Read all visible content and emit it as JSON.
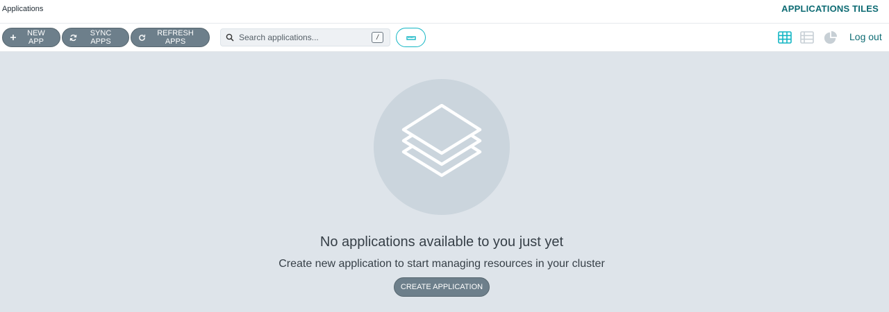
{
  "header": {
    "breadcrumb": "Applications",
    "title": "APPLICATIONS TILES"
  },
  "toolbar": {
    "new_app": {
      "icon": "plus-icon",
      "label": "NEW APP"
    },
    "sync_apps": {
      "icon": "sync-icon",
      "label": "SYNC APPS"
    },
    "refresh_apps": {
      "icon": "refresh-icon",
      "label": "REFRESH APPS"
    },
    "search": {
      "placeholder": "Search applications...",
      "value": "",
      "shortcut": "/"
    },
    "filter_button": {
      "icon": "filter-icon"
    },
    "views": [
      {
        "icon": "tiles-view-icon",
        "active": true
      },
      {
        "icon": "list-view-icon",
        "active": false
      },
      {
        "icon": "pie-chart-icon",
        "active": false
      }
    ],
    "logout": "Log out"
  },
  "empty_state": {
    "icon": "layers-icon",
    "title": "No applications available to you just yet",
    "subtitle": "Create new application to start managing resources in your cluster",
    "button": "CREATE APPLICATION"
  },
  "colors": {
    "accent": "#13b6c4",
    "heading": "#0d6b73",
    "button_bg": "#6d7f8b",
    "main_bg": "#dee4ea",
    "circle_bg": "#cbd5dd"
  }
}
